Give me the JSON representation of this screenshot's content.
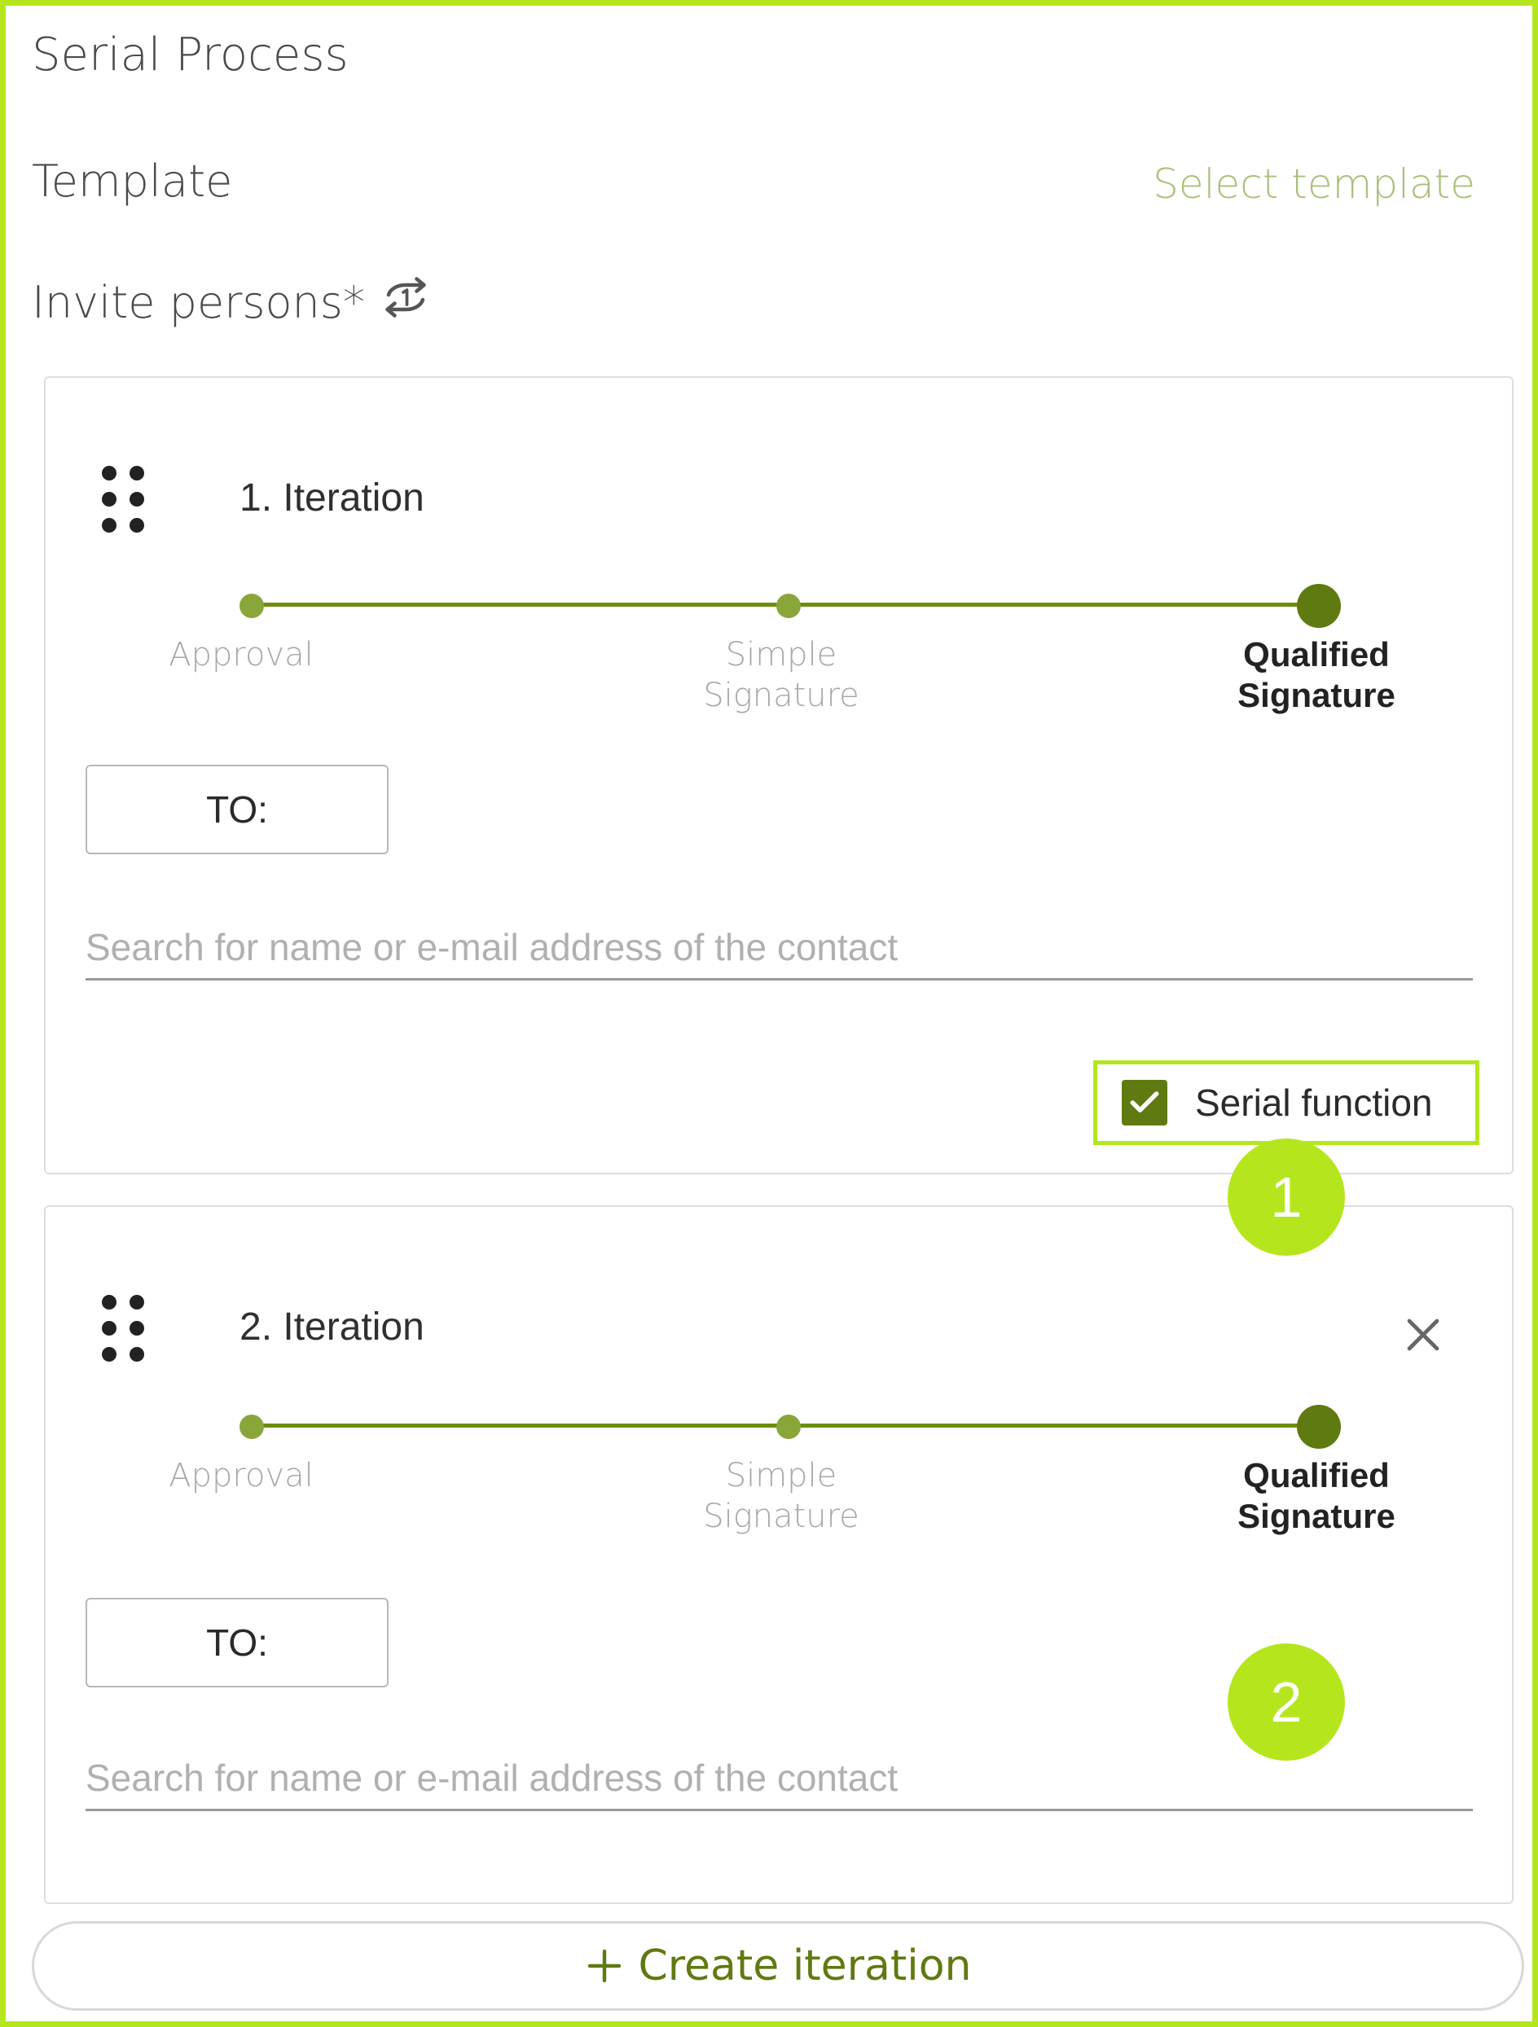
{
  "header": {
    "title": "Serial Process",
    "template_label": "Template",
    "select_template": "Select template",
    "invite_label": "Invite persons*",
    "invite_icon": "repeat-icon"
  },
  "colors": {
    "highlight": "#b5e61d",
    "accent": "#5f7a10",
    "step_dot": "#8aa63a",
    "link_muted": "#a9c07a"
  },
  "iterations": [
    {
      "title": "1. Iteration",
      "steps": [
        {
          "label": "Approval",
          "active": false
        },
        {
          "label": "Simple\nSignature",
          "active": false
        },
        {
          "label": "Qualified\nSignature",
          "active": true
        }
      ],
      "to_label": "TO:",
      "search_placeholder": "Search for name or e-mail address of the contact",
      "serial_function": {
        "label": "Serial function",
        "checked": true
      },
      "removable": false
    },
    {
      "title": "2. Iteration",
      "steps": [
        {
          "label": "Approval",
          "active": false
        },
        {
          "label": "Simple\nSignature",
          "active": false
        },
        {
          "label": "Qualified\nSignature",
          "active": true
        }
      ],
      "to_label": "TO:",
      "search_placeholder": "Search for name or e-mail address of the contact",
      "removable": true
    }
  ],
  "callouts": [
    "1",
    "2"
  ],
  "create_iteration": "Create iteration"
}
